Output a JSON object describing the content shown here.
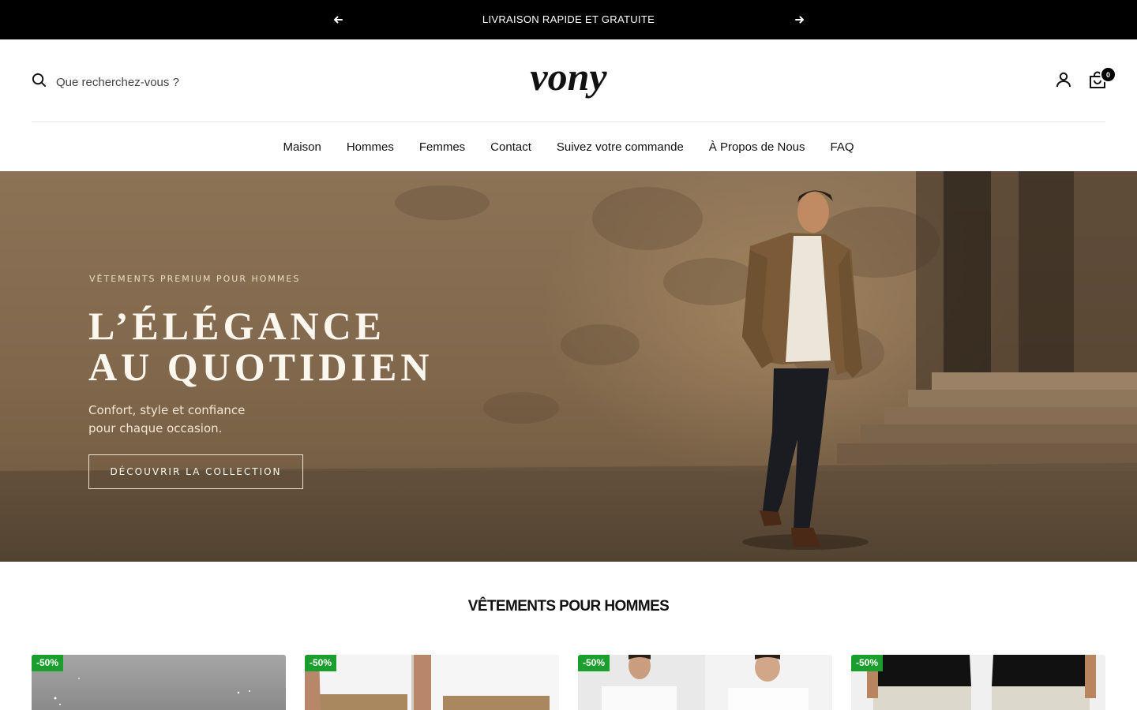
{
  "announcement": {
    "text": "LIVRAISON RAPIDE ET GRATUITE"
  },
  "header": {
    "search_placeholder": "Que recherchez-vous ?",
    "logo_text": "vony",
    "cart_count": "0"
  },
  "nav": {
    "items": [
      {
        "label": "Maison"
      },
      {
        "label": "Hommes"
      },
      {
        "label": "Femmes"
      },
      {
        "label": "Contact"
      },
      {
        "label": "Suivez votre commande"
      },
      {
        "label": "À Propos de Nous"
      },
      {
        "label": "FAQ"
      }
    ]
  },
  "hero": {
    "eyebrow": "VÊTEMENTS PREMIUM POUR HOMMES",
    "title_line1": "L’ÉLÉGANCE",
    "title_line2": "AU QUOTIDIEN",
    "subtitle_line1": "Confort, style et confiance",
    "subtitle_line2": "pour chaque occasion.",
    "cta_label": "DÉCOUVRIR LA COLLECTION"
  },
  "section": {
    "title": "VÊTEMENTS POUR HOMMES"
  },
  "products": [
    {
      "badge": "-50%"
    },
    {
      "badge": "-50%"
    },
    {
      "badge": "-50%"
    },
    {
      "badge": "-50%"
    }
  ],
  "colors": {
    "announcement_bg": "#000000",
    "sale_badge": "#1a9e2e",
    "hero_tone": "#7d6449"
  },
  "icons": [
    "arrow-left-icon",
    "arrow-right-icon",
    "search-icon",
    "user-icon",
    "cart-icon"
  ]
}
